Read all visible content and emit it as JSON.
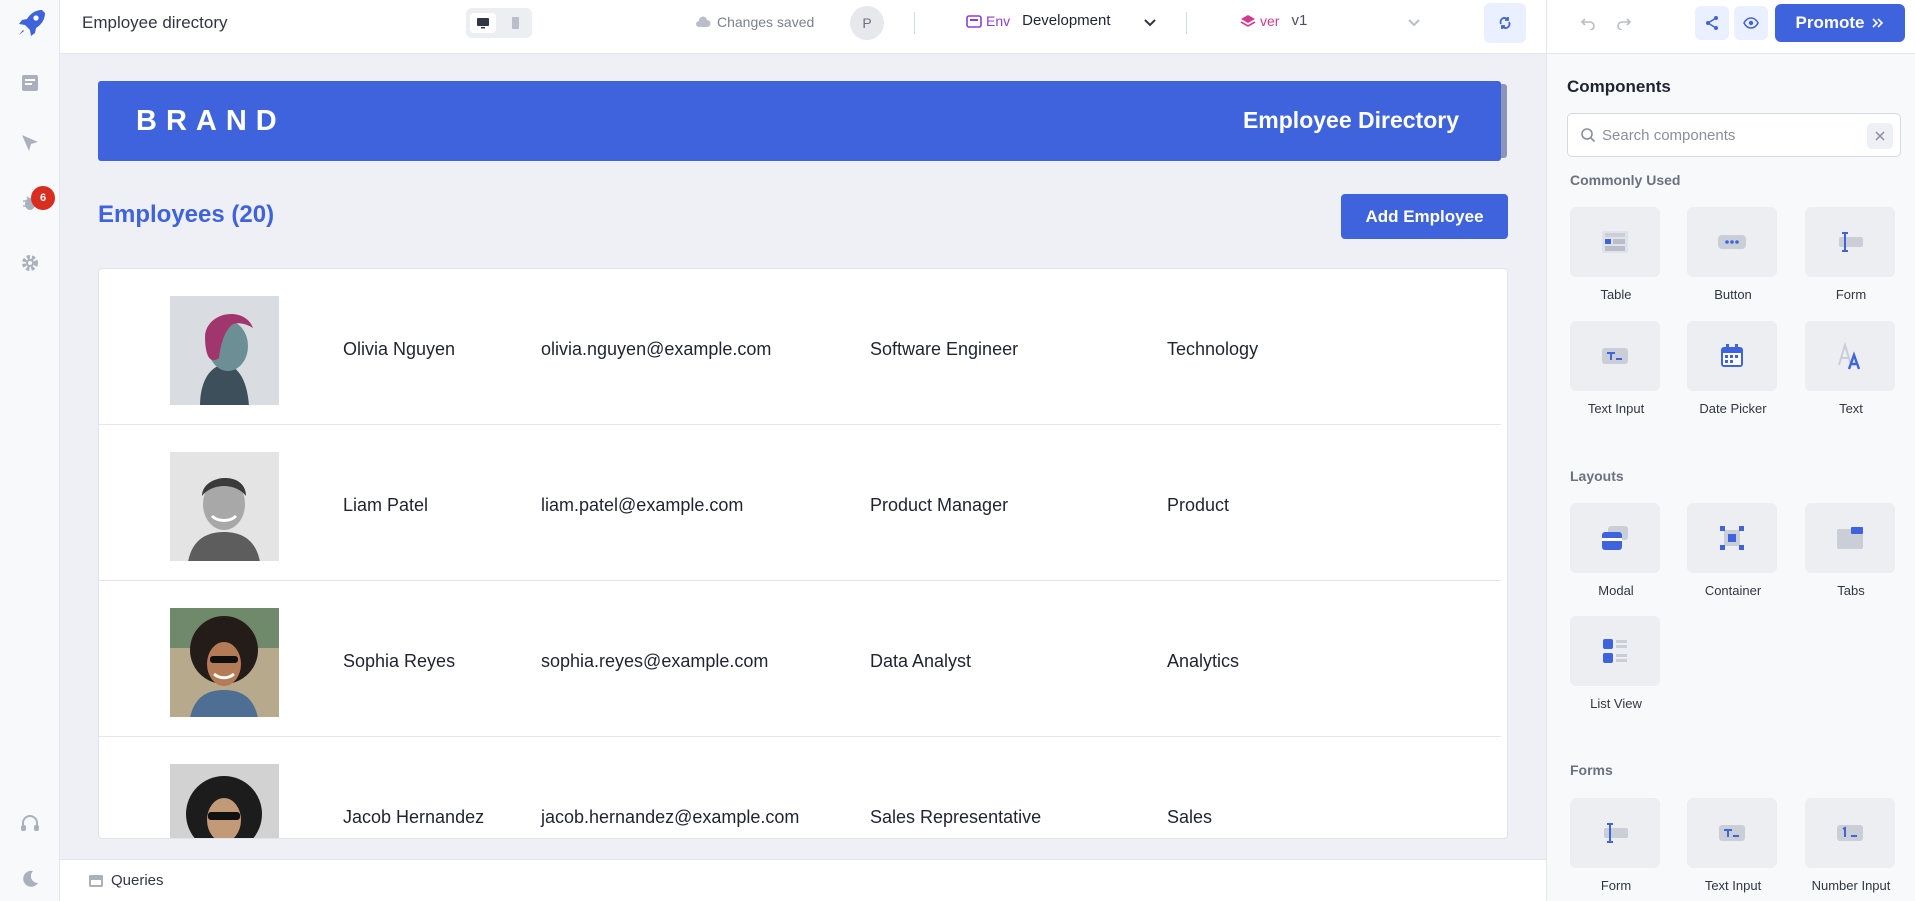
{
  "topbar": {
    "app_title": "Employee directory",
    "saved_status": "Changes saved",
    "avatar_initial": "P",
    "env_label": "Env",
    "env_value": "Development",
    "ver_label": "ver",
    "ver_value": "v1",
    "promote_label": "Promote"
  },
  "sidebar": {
    "bug_count": "6"
  },
  "canvas": {
    "brand": "BRAND",
    "banner_title": "Employee Directory",
    "heading": "Employees (20)",
    "add_button": "Add Employee",
    "employees": [
      {
        "name": "Olivia Nguyen",
        "email": "olivia.nguyen@example.com",
        "role": "Software Engineer",
        "dept": "Technology"
      },
      {
        "name": "Liam Patel",
        "email": "liam.patel@example.com",
        "role": "Product Manager",
        "dept": "Product"
      },
      {
        "name": "Sophia Reyes",
        "email": "sophia.reyes@example.com",
        "role": "Data Analyst",
        "dept": "Analytics"
      },
      {
        "name": "Jacob Hernandez",
        "email": "jacob.hernandez@example.com",
        "role": "Sales Representative",
        "dept": "Sales"
      }
    ]
  },
  "bottombar": {
    "queries_label": "Queries"
  },
  "components_panel": {
    "title": "Components",
    "search_placeholder": "Search components",
    "sections": [
      {
        "title": "Commonly Used",
        "items": [
          "Table",
          "Button",
          "Form",
          "Text Input",
          "Date Picker",
          "Text"
        ]
      },
      {
        "title": "Layouts",
        "items": [
          "Modal",
          "Container",
          "Tabs",
          "List View"
        ]
      },
      {
        "title": "Forms",
        "items": [
          "Form",
          "Text Input",
          "Number Input"
        ]
      }
    ]
  },
  "colors": {
    "accent": "#3e63dd",
    "badge": "#d92d20",
    "env": "#8b3fd9",
    "ver": "#d6398c"
  }
}
